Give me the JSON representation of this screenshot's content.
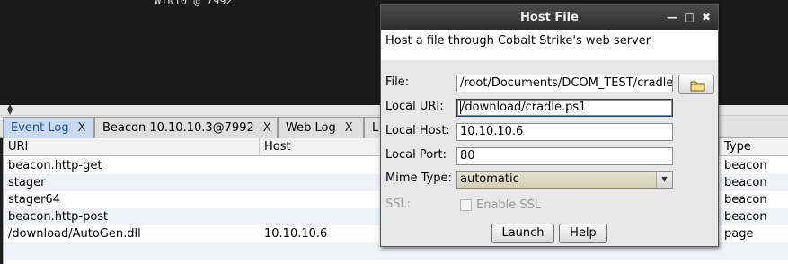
{
  "console": {
    "text": "WIN10 @ 7992"
  },
  "tabs": [
    {
      "label": "Event Log",
      "close": "X"
    },
    {
      "label": "Beacon 10.10.10.3@7992",
      "close": "X"
    },
    {
      "label": "Web Log",
      "close": "X"
    },
    {
      "label": "L",
      "close": ""
    }
  ],
  "table": {
    "columns": [
      "URI",
      "Host",
      "Type"
    ],
    "rows": [
      {
        "uri": "beacon.http-get",
        "host": "",
        "type": "beacon"
      },
      {
        "uri": "stager",
        "host": "",
        "type": "beacon"
      },
      {
        "uri": "stager64",
        "host": "",
        "type": "beacon"
      },
      {
        "uri": "beacon.http-post",
        "host": "",
        "type": "beacon"
      },
      {
        "uri": "/download/AutoGen.dll",
        "host": "10.10.10.6",
        "type": "page"
      }
    ]
  },
  "dialog": {
    "title": "Host File",
    "window_controls": {
      "minimize": "—",
      "maximize": "□",
      "close": "✖"
    },
    "description": "Host a file through Cobalt Strike's web server",
    "fields": {
      "file": {
        "label": "File:",
        "value": "/root/Documents/DCOM_TEST/cradle"
      },
      "local_uri": {
        "label": "Local URI:",
        "value": "/download/cradle.ps1"
      },
      "local_host": {
        "label": "Local Host:",
        "value": "10.10.10.6"
      },
      "local_port": {
        "label": "Local Port:",
        "value": "80"
      },
      "mime_type": {
        "label": "Mime Type:",
        "value": "automatic"
      },
      "ssl": {
        "label": "SSL:",
        "checkbox_label": "Enable SSL",
        "checked": false,
        "enabled": false
      }
    },
    "buttons": {
      "launch": "Launch",
      "help": "Help"
    },
    "icons": {
      "file_browse": "folder-icon",
      "dropdown": "chevron-down-icon"
    }
  }
}
